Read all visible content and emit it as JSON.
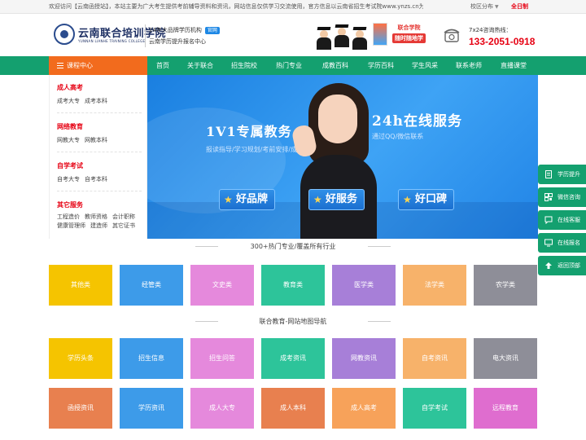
{
  "topbar": {
    "notice": "欢迎访问【云南函授站】，本站主要为广大考生提供考前辅导资料和资讯，网站信息仅供学习交流使用，官方信息以云南省招生考试院www.ynzs.cn为准。",
    "region": "校区分布",
    "hosts": "全日制"
  },
  "header": {
    "logo_cn": "云南联合培训学院",
    "logo_en": "YUNNAN LIANHE TRAINING COLLEGE",
    "slogan1": "24年大品牌学历机构",
    "official_badge": "官网",
    "slogan2": "云南学历提升报名中心",
    "study_line1": "联合学院",
    "study_line2": "随时随地学",
    "hotline_label": "7x24咨询热线：",
    "hotline_number": "133-2051-0918"
  },
  "nav": {
    "course_center": "课程中心",
    "items": [
      "首页",
      "关于联合",
      "招生院校",
      "热门专业",
      "成教百科",
      "学历百科",
      "学生风采",
      "联系老师",
      "直播课堂"
    ]
  },
  "sidebar": {
    "groups": [
      {
        "title": "成人高考",
        "links": [
          "成考大专",
          "成考本科"
        ]
      },
      {
        "title": "网络教育",
        "links": [
          "网教大专",
          "网教本科"
        ]
      },
      {
        "title": "自学考试",
        "links": [
          "自考大专",
          "自考本科"
        ]
      },
      {
        "title": "其它服务",
        "links": [
          "工程造价",
          "教师资格",
          "会计职称",
          "健康管理师",
          "建造师",
          "其它证书"
        ]
      }
    ]
  },
  "banner": {
    "headline1": "1V1专属教务",
    "headline2": "24h在线服务",
    "sub1": "报读指导/学习规划/考前安排/成绩",
    "sub2": "通过QQ/微信联系",
    "badges": [
      "好品牌",
      "好服务",
      "好口碑"
    ]
  },
  "majors": {
    "title": "300+热门专业/覆盖所有行业",
    "tiles": [
      {
        "label": "其他类",
        "color": "#f5c400"
      },
      {
        "label": "经管类",
        "color": "#3d9be9"
      },
      {
        "label": "文史类",
        "color": "#e589dc"
      },
      {
        "label": "教育类",
        "color": "#2dc49a"
      },
      {
        "label": "医学类",
        "color": "#a77fd8"
      },
      {
        "label": "法学类",
        "color": "#f7b26a"
      },
      {
        "label": "农学类",
        "color": "#8e8e98"
      }
    ]
  },
  "sitemap": {
    "title": "联合教育-网站地图导航",
    "row1": [
      {
        "label": "学历头条",
        "color": "#f5c400"
      },
      {
        "label": "招生信息",
        "color": "#3d9be9"
      },
      {
        "label": "招生问答",
        "color": "#e589dc"
      },
      {
        "label": "成考资讯",
        "color": "#2dc49a"
      },
      {
        "label": "网教资讯",
        "color": "#a77fd8"
      },
      {
        "label": "自考资讯",
        "color": "#f7b26a"
      },
      {
        "label": "电大资讯",
        "color": "#8e8e98"
      }
    ],
    "row2": [
      {
        "label": "函授资讯",
        "color": "#e8804f"
      },
      {
        "label": "学历资讯",
        "color": "#3d9be9"
      },
      {
        "label": "成人大专",
        "color": "#e589dc"
      },
      {
        "label": "成人本科",
        "color": "#e8804f"
      },
      {
        "label": "成人高考",
        "color": "#f7a25a"
      },
      {
        "label": "自学考试",
        "color": "#2dc49a"
      },
      {
        "label": "远程教育",
        "color": "#df6dcf"
      }
    ]
  },
  "float_bar": {
    "items": [
      "学历提升",
      "微信咨询",
      "在线客服",
      "在线报名",
      "返回顶部"
    ]
  }
}
